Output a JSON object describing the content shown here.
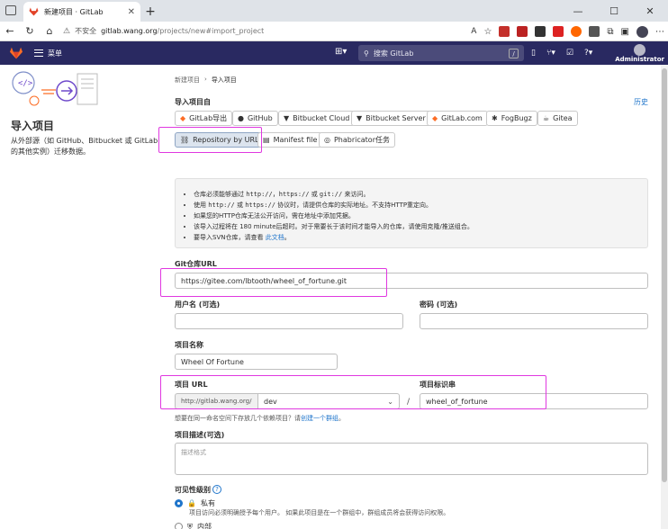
{
  "browser": {
    "tab_title": "新建项目 · GitLab",
    "tab_close": "✕",
    "new_tab": "+",
    "minimize": "—",
    "maximize": "☐",
    "close": "✕",
    "insecure_label": "不安全",
    "url_host": "gitlab.wang.org",
    "url_path": "/projects/new#import_project"
  },
  "header": {
    "menu_label": "菜单",
    "search_placeholder": "搜索 GitLab",
    "search_shortcut": "/",
    "user_name": "Administrator"
  },
  "left": {
    "title": "导入项目",
    "description": "从外部源（如 GitHub、Bitbucket 或 GitLab 的其他实例）迁移数据。"
  },
  "breadcrumb": {
    "parent": "新建项目",
    "sep": "›",
    "current": "导入项目"
  },
  "import_section": {
    "label": "导入项目自",
    "history": "历史",
    "sources": [
      {
        "label": "GitLab导出",
        "icon": "gitlab-icon"
      },
      {
        "label": "GitHub",
        "icon": "github-icon"
      },
      {
        "label": "Bitbucket Cloud",
        "icon": "bitbucket-icon"
      },
      {
        "label": "Bitbucket Server",
        "icon": "bitbucket-icon"
      },
      {
        "label": "GitLab.com",
        "icon": "gitlab-icon"
      },
      {
        "label": "FogBugz",
        "icon": "fogbugz-icon"
      },
      {
        "label": "Gitea",
        "icon": "gitea-icon"
      }
    ],
    "sources_row2": [
      {
        "label": "Repository by URL",
        "icon": "link-icon"
      },
      {
        "label": "Manifest file",
        "icon": "file-icon"
      },
      {
        "label": "Phabricator任务",
        "icon": "phabricator-icon"
      }
    ]
  },
  "info": {
    "line1_a": "仓库必须能够通过 ",
    "line1_code1": "http://",
    "line1_b": "，",
    "line1_code2": "https://",
    "line1_c": " 或 ",
    "line1_code3": "git://",
    "line1_d": " 来访问。",
    "line2_a": "使用 ",
    "line2_code1": "http://",
    "line2_b": " 或 ",
    "line2_code2": "https://",
    "line2_c": " 协议时，请提供仓库的实际地址。不支持HTTP重定向。",
    "line3": "如果您的HTTP仓库无法公开访问，需在地址中添加凭据。",
    "line4": "该导入过程将在 180 minute后超时。对于需要长于该时间才能导入的仓库，请使用克隆/推送组合。",
    "line5_a": "要导入SVN仓库，请查看 ",
    "line5_link": "此文档",
    "line5_b": "。"
  },
  "form": {
    "git_url_label": "Git仓库URL",
    "git_url_value": "https://gitee.com/lbtooth/wheel_of_fortune.git",
    "username_label": "用户名 (可选)",
    "username_value": "",
    "password_label": "密码 (可选)",
    "password_value": "",
    "project_name_label": "项目名称",
    "project_name_value": "Wheel Of Fortune",
    "project_url_label": "项目 URL",
    "project_url_prefix": "http://gitlab.wang.org/",
    "project_url_namespace": "dev",
    "project_slug_label": "项目标识串",
    "project_slug_value": "wheel_of_fortune",
    "slash": "/",
    "help_a": "想要在同一命名空间下存放几个依赖项目？请",
    "help_link": "创建一个群组",
    "help_b": "。",
    "description_label": "项目描述(可选)",
    "description_placeholder": "描述格式",
    "visibility_label": "可见性级别",
    "visibility_private": "私有",
    "visibility_private_desc": "项目访问必须明确授予每个用户。 如果此项目是在一个群组中，群组成员将会获得访问权限。",
    "visibility_internal": "内部"
  },
  "colors": {
    "gitlab_header": "#292961",
    "link": "#1f75cb",
    "highlight": "#e038e0"
  }
}
